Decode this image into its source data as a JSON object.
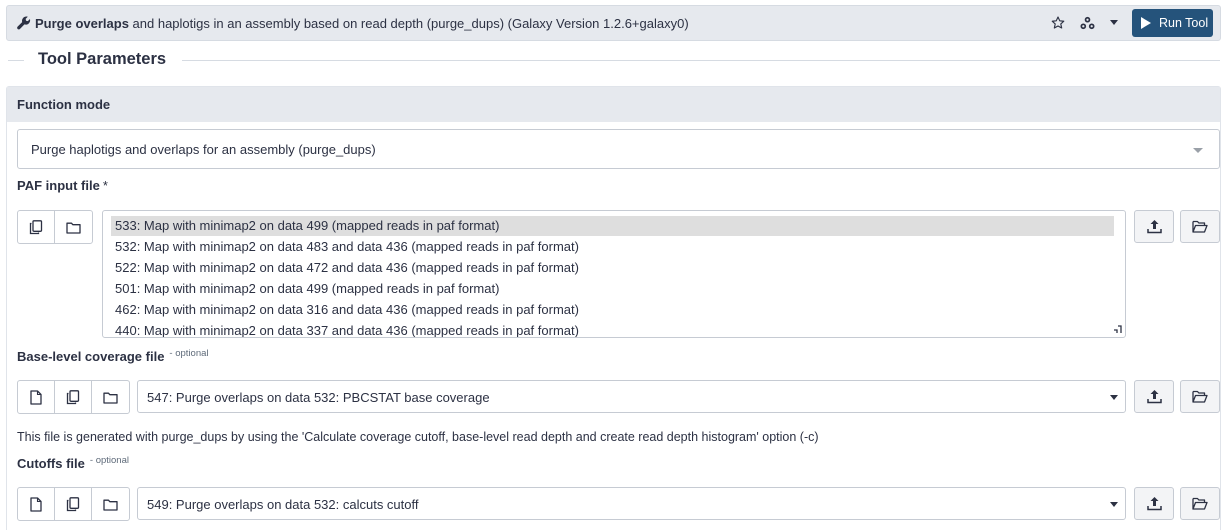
{
  "header": {
    "title_bold": "Purge overlaps",
    "title_rest": " and haplotigs in an assembly based on read depth (purge_dups) (Galaxy Version 1.2.6+galaxy0)",
    "run_label": "Run Tool",
    "icons": [
      "wrench-icon",
      "star-icon",
      "sitemap-icon",
      "caret-down-icon",
      "play-icon"
    ]
  },
  "legend": "Tool Parameters",
  "function_mode": {
    "title": "Function mode",
    "selected": "Purge haplotigs and overlaps for an assembly (purge_dups)"
  },
  "paf": {
    "label": "PAF input file",
    "required_marker": "*",
    "options": [
      "533: Map with minimap2 on data 499 (mapped reads in paf format)",
      "532: Map with minimap2 on data 483 and data 436 (mapped reads in paf format)",
      "522: Map with minimap2 on data 472 and data 436 (mapped reads in paf format)",
      "501: Map with minimap2 on data 499 (mapped reads in paf format)",
      "462: Map with minimap2 on data 316 and data 436 (mapped reads in paf format)",
      "440: Map with minimap2 on data 337 and data 436 (mapped reads in paf format)"
    ]
  },
  "base_cov": {
    "label": "Base-level coverage file",
    "optional": "- optional",
    "selected": "547: Purge overlaps on data 532: PBCSTAT base coverage",
    "help": "This file is generated with purge_dups by using the 'Calculate coverage cutoff, base-level read depth and create read depth histogram' option (-c)"
  },
  "cutoffs": {
    "label": "Cutoffs file",
    "optional": "- optional",
    "selected": "549: Purge overlaps on data 532: calcuts cutoff"
  },
  "colors": {
    "run_button": "#25537b",
    "header_bg": "#e6e9ee",
    "selected_row": "#dedede"
  }
}
